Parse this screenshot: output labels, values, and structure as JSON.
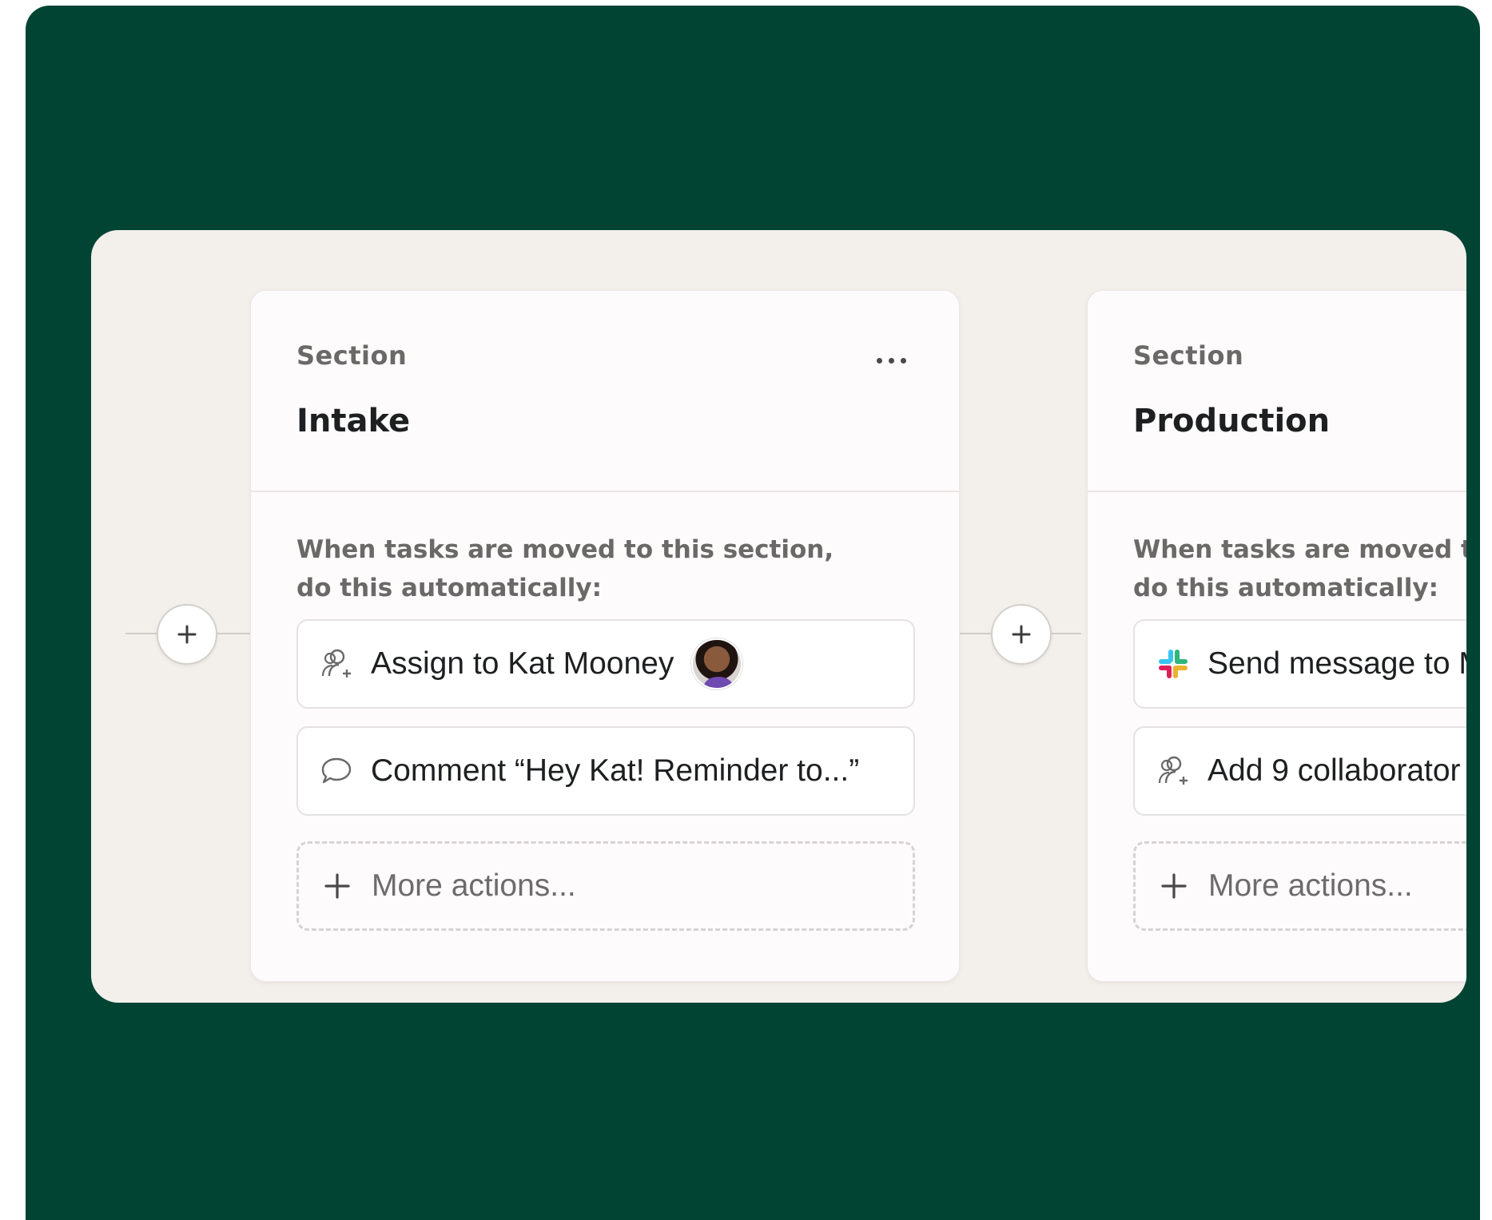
{
  "sections": [
    {
      "eyebrow": "Section",
      "title": "Intake",
      "rule_line1": "When tasks are moved to this section,",
      "rule_line2": "do this automatically:",
      "actions": [
        {
          "icon": "assign-people-icon",
          "label": "Assign to Kat Mooney"
        },
        {
          "icon": "comment-bubble-icon",
          "label": "Comment “Hey Kat! Reminder to...”"
        }
      ],
      "more_label": "More actions..."
    },
    {
      "eyebrow": "Section",
      "title": "Production",
      "rule_line1": "When tasks are moved to",
      "rule_line2": "do this automatically:",
      "actions": [
        {
          "icon": "slack-icon",
          "label": "Send message to M"
        },
        {
          "icon": "assign-people-icon",
          "label": "Add 9 collaborator"
        }
      ],
      "more_label": "More actions..."
    }
  ],
  "colors": {
    "frame_bg": "#024434",
    "panel_bg": "#f3efeb",
    "card_bg": "#fdfbfc",
    "title_text": "#1e1f21",
    "muted_text": "#6b6868"
  }
}
